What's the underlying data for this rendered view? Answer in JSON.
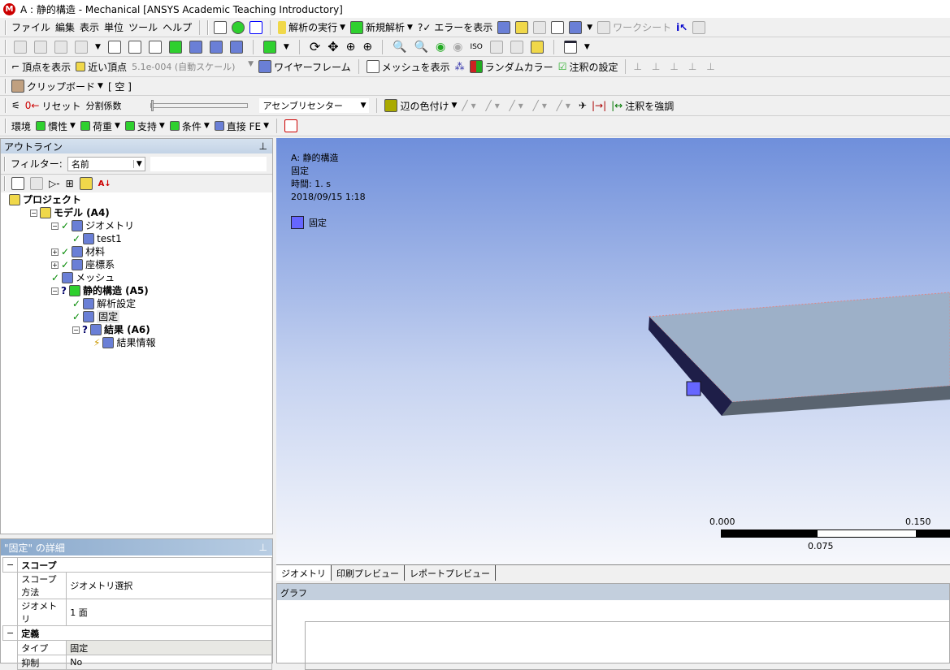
{
  "title": "A : 静的構造 - Mechanical [ANSYS Academic Teaching Introductory]",
  "menu": [
    "ファイル",
    "編集",
    "表示",
    "単位",
    "ツール",
    "ヘルプ"
  ],
  "toolbar1": {
    "solve": "解析の実行",
    "new_analysis": "新規解析",
    "show_errors": "?✓ エラーを表示",
    "worksheet": "ワークシート"
  },
  "toolbar3": {
    "show_vertices": "頂点を表示",
    "close_vertices": "近い頂点",
    "scale": "5.1e-004 (自動スケール)",
    "wireframe": "ワイヤーフレーム",
    "show_mesh": "メッシュを表示",
    "random_colors": "ランダムカラー",
    "annotation_settings": "注釈の設定"
  },
  "toolbar4": {
    "clipboard": "クリップボード",
    "clipboard_state": "[ 空 ]"
  },
  "toolbar5": {
    "reset": "リセット",
    "split_factor": "分割係数",
    "center": "アセンブリセンター",
    "edge_coloring": "辺の色付け",
    "highlight_annotation": "注釈を強調"
  },
  "toolbar6": [
    "環境",
    "慣性",
    "荷重",
    "支持",
    "条件",
    "直接 FE"
  ],
  "outline": {
    "title": "アウトライン",
    "filter_label": "フィルター:",
    "filter_value": "名前",
    "search_value": "",
    "tree": [
      {
        "label": "プロジェクト",
        "bold": true,
        "level": 0
      },
      {
        "label": "モデル (A4)",
        "bold": true,
        "level": 1,
        "status": ""
      },
      {
        "label": "ジオメトリ",
        "level": 2,
        "status": "check"
      },
      {
        "label": "test1",
        "level": 3,
        "status": "check"
      },
      {
        "label": "材料",
        "level": 2,
        "status": "check"
      },
      {
        "label": "座標系",
        "level": 2,
        "status": "check"
      },
      {
        "label": "メッシュ",
        "level": 2,
        "status": "check"
      },
      {
        "label": "静的構造 (A5)",
        "bold": true,
        "level": 2,
        "status": "question"
      },
      {
        "label": "解析設定",
        "level": 3,
        "status": "check"
      },
      {
        "label": "固定",
        "level": 3,
        "status": "check",
        "selected": true
      },
      {
        "label": "結果 (A6)",
        "bold": true,
        "level": 3,
        "status": "question"
      },
      {
        "label": "結果情報",
        "level": 4,
        "status": "lightning"
      }
    ]
  },
  "details": {
    "title": "\"固定\" の詳細",
    "sections": [
      {
        "name": "スコープ",
        "rows": [
          [
            "スコープ方法",
            "ジオメトリ選択"
          ],
          [
            "ジオメトリ",
            "1 面"
          ]
        ]
      },
      {
        "name": "定義",
        "rows": [
          [
            "タイプ",
            "固定"
          ],
          [
            "抑制",
            "No"
          ]
        ]
      }
    ]
  },
  "viewport": {
    "analysis": "A: 静的構造",
    "item": "固定",
    "time": "時間: 1. s",
    "date": "2018/09/15 1:18",
    "legend": "固定",
    "legend_color": "#6666ff",
    "scale": [
      "0.000",
      "0.075",
      "0.150"
    ]
  },
  "tabs": [
    "ジオメトリ",
    "印刷プレビュー",
    "レポートプレビュー"
  ],
  "graph": {
    "title": "グラフ"
  }
}
